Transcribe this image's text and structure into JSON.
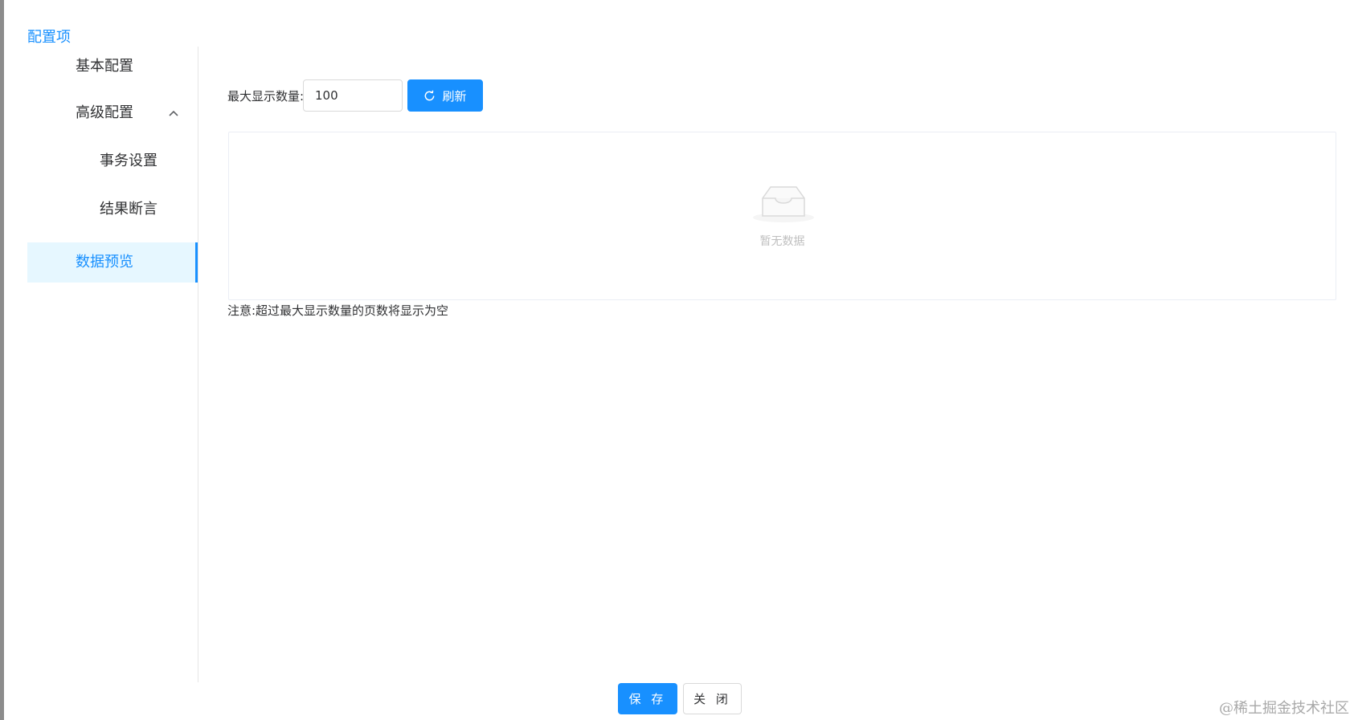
{
  "section_title": "配置项",
  "sidebar": {
    "items": [
      {
        "label": "基本配置"
      },
      {
        "label": "高级配置"
      },
      {
        "label": "事务设置"
      },
      {
        "label": "结果断言"
      },
      {
        "label": "数据预览"
      }
    ]
  },
  "toolbar": {
    "max_label": "最大显示数量:",
    "max_value": "100",
    "refresh_label": "刷新"
  },
  "table": {
    "empty_text": "暂无数据"
  },
  "note": "注意:超过最大显示数量的页数将显示为空",
  "footer": {
    "save_label": "保 存",
    "close_label": "关 闭"
  },
  "watermark": "@稀土掘金技术社区",
  "colors": {
    "accent": "#1890ff",
    "active_bg": "#e6f7ff"
  },
  "icons": {
    "refresh": "refresh-icon",
    "chevron": "chevron-up-icon",
    "empty": "empty-inbox-icon"
  }
}
